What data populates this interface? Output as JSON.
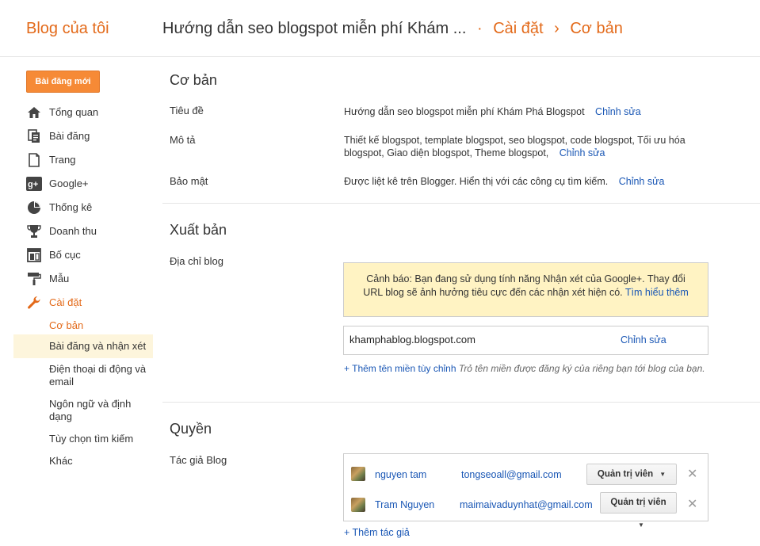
{
  "header": {
    "brand": "Blog của tôi",
    "blog_title": "Hướng dẫn seo blogspot miễn phí Khám ...",
    "sep1": "·",
    "crumb_settings": "Cài đặt",
    "sep2": "›",
    "crumb_basic": "Cơ bản"
  },
  "new_post_label": "Bài đăng mới",
  "nav": {
    "items": [
      {
        "label": "Tổng quan",
        "icon": "home-icon"
      },
      {
        "label": "Bài đăng",
        "icon": "posts-icon"
      },
      {
        "label": "Trang",
        "icon": "pages-icon"
      },
      {
        "label": "Google+",
        "icon": "google-plus-icon"
      },
      {
        "label": "Thống kê",
        "icon": "stats-pie-icon"
      },
      {
        "label": "Doanh thu",
        "icon": "trophy-icon"
      },
      {
        "label": "Bố cục",
        "icon": "layout-icon"
      },
      {
        "label": "Mẫu",
        "icon": "paint-roller-icon"
      },
      {
        "label": "Cài đặt",
        "icon": "wrench-icon"
      }
    ],
    "subitems": [
      "Cơ bản",
      "Bài đăng và nhận xét",
      "Điện thoại di động và email",
      "Ngôn ngữ và định dạng",
      "Tùy chọn tìm kiếm",
      "Khác"
    ]
  },
  "basic": {
    "title": "Cơ bản",
    "rows": [
      {
        "label": "Tiêu đề",
        "value": "Hướng dẫn seo blogspot miễn phí Khám Phá Blogspot",
        "edit": "Chỉnh sửa"
      },
      {
        "label": "Mô tả",
        "value": "Thiết kế blogspot, template blogspot, seo blogspot, code blogspot, Tối ưu hóa blogspot, Giao diện blogspot, Theme blogspot,",
        "edit": "Chỉnh sửa"
      },
      {
        "label": "Bảo mật",
        "value": "Được liệt kê trên Blogger. Hiển thị với các công cụ tìm kiếm.",
        "edit": "Chỉnh sửa"
      }
    ]
  },
  "publish": {
    "title": "Xuất bản",
    "address_label": "Địa chỉ blog",
    "warning": "Cảnh báo: Bạn đang sử dụng tính năng Nhận xét của Google+. Thay đổi URL blog sẽ ảnh hưởng tiêu cực đến các nhận xét hiện có.",
    "warning_link": "Tìm hiểu thêm",
    "domain": "khamphablog.blogspot.com",
    "domain_edit": "Chỉnh sửa",
    "add_domain": "+ Thêm tên miền tùy chỉnh",
    "add_domain_hint": "Trỏ tên miền được đăng ký của riêng bạn tới blog của bạn."
  },
  "permissions": {
    "title": "Quyền",
    "authors_label": "Tác giả Blog",
    "authors": [
      {
        "name": "nguyen tam",
        "email": "tongseoall@gmail.com",
        "role": "Quản trị viên"
      },
      {
        "name": "Tram Nguyen",
        "email": "maimaivaduynhat@gmail.com",
        "role": "Quản trị viên"
      }
    ],
    "remove_symbol": "✕",
    "add_author": "+ Thêm tác giả"
  },
  "colors": {
    "accent": "#e36a1a",
    "link": "#1a57b5",
    "new_post_button": "#f68a36",
    "warning_bg": "#fff3c3",
    "nav_highlight_bg": "#fdf5dc"
  }
}
